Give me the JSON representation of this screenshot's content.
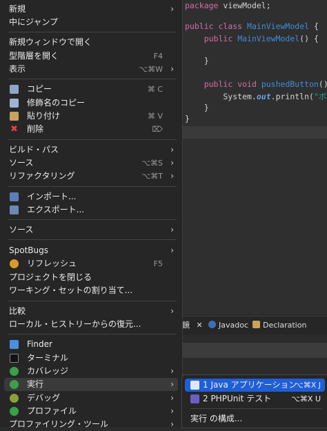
{
  "editor": {
    "lines": [
      {
        "parts": [
          [
            "kw",
            "package"
          ],
          [
            "",
            " viewModel;"
          ]
        ]
      },
      {
        "parts": []
      },
      {
        "parts": [
          [
            "kw",
            "public"
          ],
          [
            "",
            " "
          ],
          [
            "kw",
            "class"
          ],
          [
            "",
            " "
          ],
          [
            "cls",
            "MainViewModel"
          ],
          [
            "",
            " {"
          ]
        ]
      },
      {
        "parts": [
          [
            "",
            "    "
          ],
          [
            "kw",
            "public"
          ],
          [
            "",
            " "
          ],
          [
            "cls",
            "MainViewModel"
          ],
          [
            "",
            "() {"
          ]
        ]
      },
      {
        "parts": []
      },
      {
        "parts": [
          [
            "",
            "    }"
          ]
        ]
      },
      {
        "parts": []
      },
      {
        "parts": [
          [
            "",
            "    "
          ],
          [
            "kw",
            "public"
          ],
          [
            "",
            " "
          ],
          [
            "kw",
            "void"
          ],
          [
            "",
            " "
          ],
          [
            "cls",
            "pushedButton"
          ],
          [
            "",
            "() {"
          ]
        ]
      },
      {
        "parts": [
          [
            "",
            "        System."
          ],
          [
            "fld",
            "out"
          ],
          [
            "",
            ".println("
          ],
          [
            "str",
            "\"ボタン"
          ]
        ]
      },
      {
        "parts": [
          [
            "",
            "    }"
          ]
        ]
      },
      {
        "parts": [
          [
            "",
            "}"
          ]
        ]
      }
    ]
  },
  "panel": {
    "tabs": [
      {
        "label": "鏡",
        "close": "✕"
      },
      {
        "label": "Javadoc"
      },
      {
        "label": "Declaration"
      }
    ]
  },
  "menu": {
    "items": [
      {
        "label": "新規",
        "arrow": "›"
      },
      {
        "label": "中にジャンプ"
      },
      {
        "label": "新規ウィンドウで開く"
      },
      {
        "label": "型階層を開く",
        "shortcut": "F4"
      },
      {
        "label": "表示",
        "shortcut": "⌥⌘W",
        "arrow": "›"
      },
      {
        "label": "コピー",
        "shortcut": "⌘ C",
        "icon": "copy-icon"
      },
      {
        "label": "修飾名のコピー",
        "icon": "qualified-copy-icon"
      },
      {
        "label": "貼り付け",
        "shortcut": "⌘ V",
        "icon": "paste-icon"
      },
      {
        "label": "削除",
        "shortcut": "⌦",
        "icon": "delete-icon"
      },
      {
        "label": "ビルド・パス",
        "arrow": "›"
      },
      {
        "label": "ソース",
        "shortcut": "⌥⌘S",
        "arrow": "›"
      },
      {
        "label": "リファクタリング",
        "shortcut": "⌥⌘T",
        "arrow": "›"
      },
      {
        "label": "インポート...",
        "icon": "import-icon"
      },
      {
        "label": "エクスポート...",
        "icon": "export-icon"
      },
      {
        "label": "ソース",
        "arrow": "›"
      },
      {
        "label": "SpotBugs",
        "arrow": "›"
      },
      {
        "label": "リフレッシュ",
        "shortcut": "F5",
        "icon": "refresh-icon"
      },
      {
        "label": "プロジェクトを閉じる"
      },
      {
        "label": "ワーキング・セットの割り当て..."
      },
      {
        "label": "比較",
        "arrow": "›"
      },
      {
        "label": "ローカル・ヒストリーからの復元..."
      },
      {
        "label": "Finder",
        "icon": "finder-icon"
      },
      {
        "label": "ターミナル",
        "icon": "terminal-icon"
      },
      {
        "label": "カバレッジ",
        "arrow": "›",
        "icon": "coverage-icon"
      },
      {
        "label": "実行",
        "arrow": "›",
        "icon": "run-icon"
      },
      {
        "label": "デバッグ",
        "arrow": "›",
        "icon": "debug-icon"
      },
      {
        "label": "プロファイル",
        "arrow": "›",
        "icon": "profile-icon"
      },
      {
        "label": "プロファイリング・ツール",
        "arrow": "›"
      }
    ]
  },
  "submenu": {
    "items": [
      {
        "label": "1 Java アプリケーション",
        "shortcut": "⌥⌘X J",
        "icon": "java-app-icon"
      },
      {
        "label": "2 PHPUnit テスト",
        "shortcut": "⌥⌘X U",
        "icon": "phpunit-icon"
      },
      {
        "label": "実行 の構成..."
      }
    ]
  },
  "colors": {
    "menu_bg": "#262626",
    "highlight": "#1f5fd6",
    "keyword": "#d36fa8",
    "class": "#3e8ddb",
    "string": "#20a48f"
  }
}
